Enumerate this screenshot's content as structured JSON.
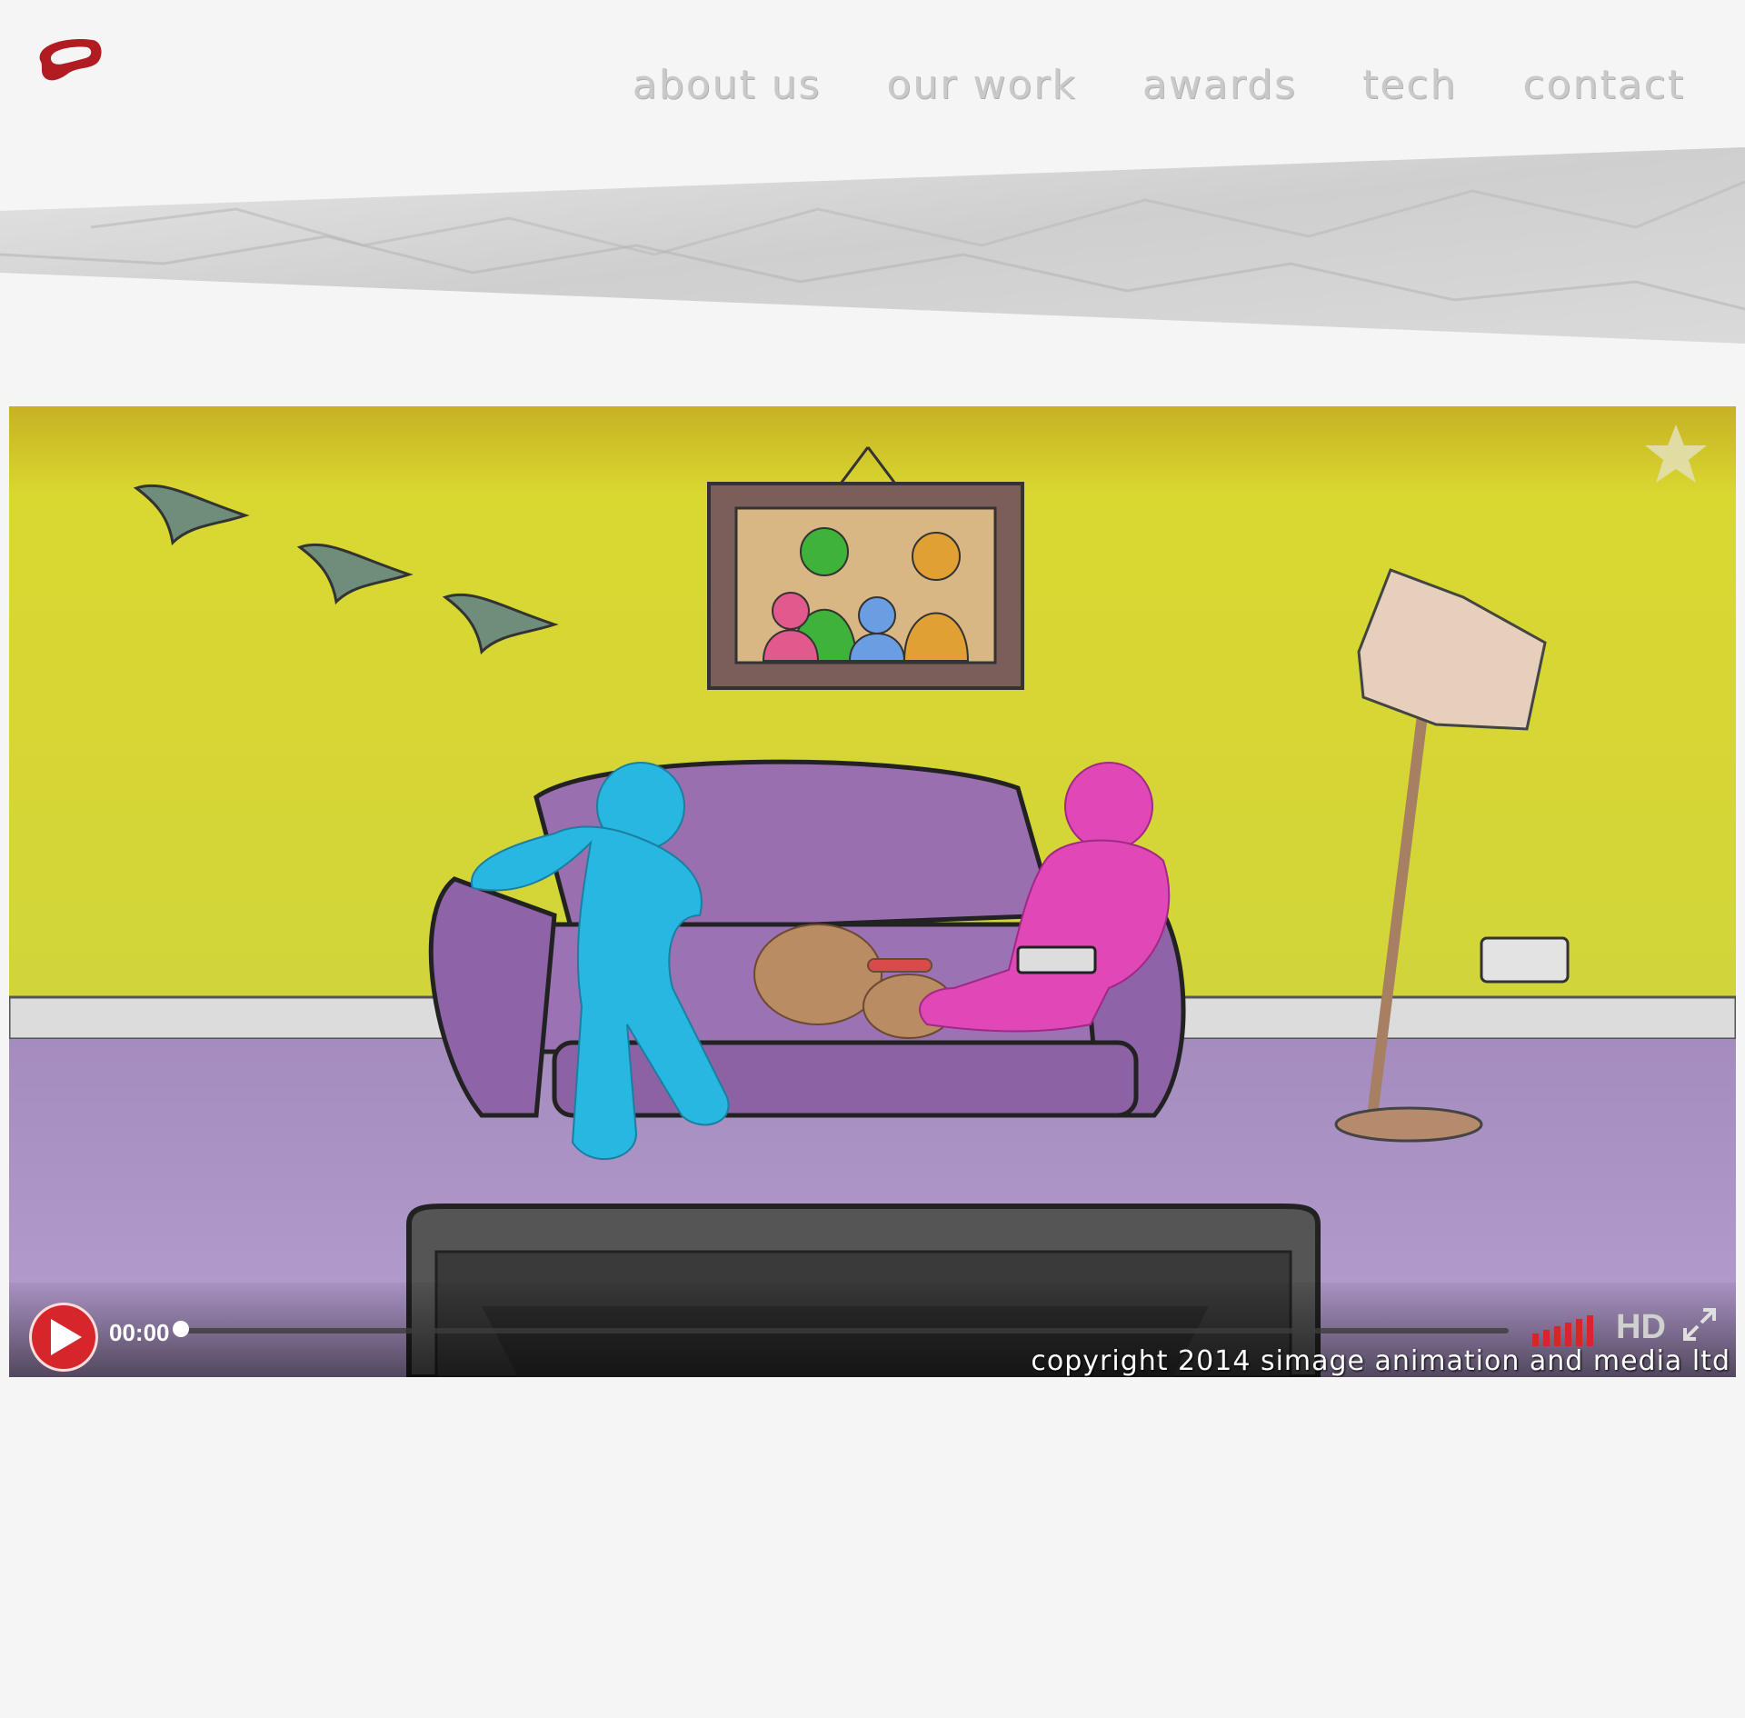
{
  "nav": {
    "items": [
      "about us",
      "our work",
      "awards",
      "tech",
      "contact"
    ]
  },
  "player": {
    "time": "00:00",
    "quality_label": "HD",
    "copyright": "copyright 2014 simage animation and media ltd",
    "progress": 0
  },
  "colors": {
    "logo_red": "#b01c22",
    "nav_text": "#c9c9c9",
    "play_red": "#d7262b",
    "wall_yellow": "#d8d83a",
    "sofa_purple": "#9a6fb0",
    "carpet_purple": "#b497c8"
  },
  "icons": [
    "logo-icon",
    "favorite-star-icon",
    "play-icon",
    "volume-icon",
    "fullscreen-icon"
  ]
}
